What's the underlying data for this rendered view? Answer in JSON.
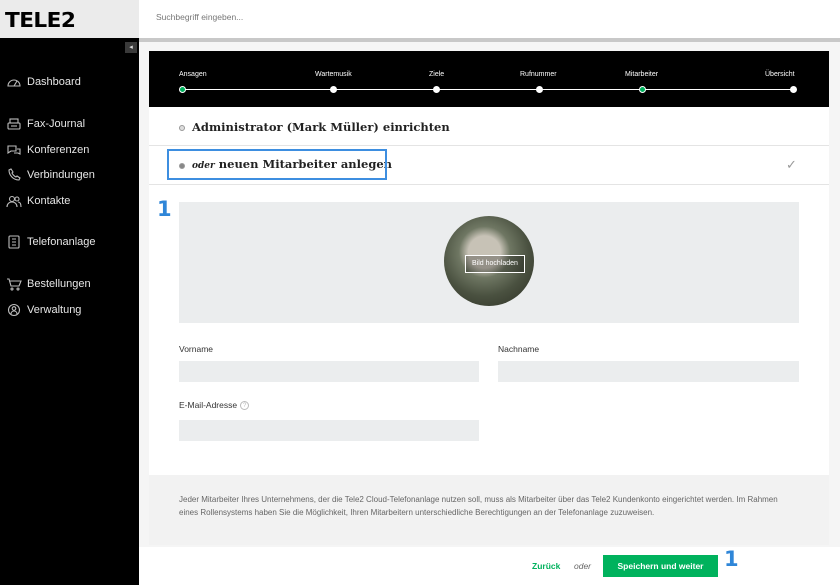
{
  "brand": {
    "logo": "TELE2"
  },
  "search": {
    "placeholder": "Suchbegriff eingeben..."
  },
  "sidebar": {
    "collapse_icon": "◂",
    "items": [
      {
        "label": "Dashboard",
        "icon": "gauge-icon"
      },
      {
        "label": "Fax-Journal",
        "icon": "fax-icon"
      },
      {
        "label": "Konferenzen",
        "icon": "conference-icon"
      },
      {
        "label": "Verbindungen",
        "icon": "phone-icon"
      },
      {
        "label": "Kontakte",
        "icon": "contacts-icon"
      },
      {
        "label": "Telefonanlage",
        "icon": "pbx-icon"
      },
      {
        "label": "Bestellungen",
        "icon": "cart-icon"
      },
      {
        "label": "Verwaltung",
        "icon": "admin-icon"
      }
    ]
  },
  "stepper": {
    "steps": [
      {
        "label": "Ansagen",
        "state": "done"
      },
      {
        "label": "Wartemusik",
        "state": "open"
      },
      {
        "label": "Ziele",
        "state": "open"
      },
      {
        "label": "Rufnummer",
        "state": "open"
      },
      {
        "label": "Mitarbeiter",
        "state": "done"
      },
      {
        "label": "Übersicht",
        "state": "open"
      }
    ]
  },
  "options": {
    "admin": {
      "label": "Administrator (Mark Müller) einrichten"
    },
    "new_employee": {
      "prefix": "oder",
      "label": "neuen Mitarbeiter anlegen",
      "check": "✓"
    }
  },
  "upload": {
    "button": "Bild hochladen"
  },
  "form": {
    "first_name_label": "Vorname",
    "last_name_label": "Nachname",
    "email_label": "E-Mail-Adresse",
    "help_glyph": "?"
  },
  "info_text": "Jeder Mitarbeiter Ihres Unternehmens, der die Tele2 Cloud-Telefonanlage nutzen soll, muss als Mitarbeiter über das Tele2 Kundenkonto eingerichtet werden. Im Rahmen eines Rollensystems haben Sie die Möglichkeit, Ihren Mitarbeitern unterschiedliche Berechtigungen an der Telefonanlage zuzuweisen.",
  "footer": {
    "back": "Zurück",
    "or": "oder",
    "save": "Speichern und weiter"
  },
  "annotations": {
    "marker_left": "1",
    "marker_right": "1"
  },
  "colors": {
    "accent_green": "#00b25d",
    "highlight_blue": "#3d8ee0"
  }
}
